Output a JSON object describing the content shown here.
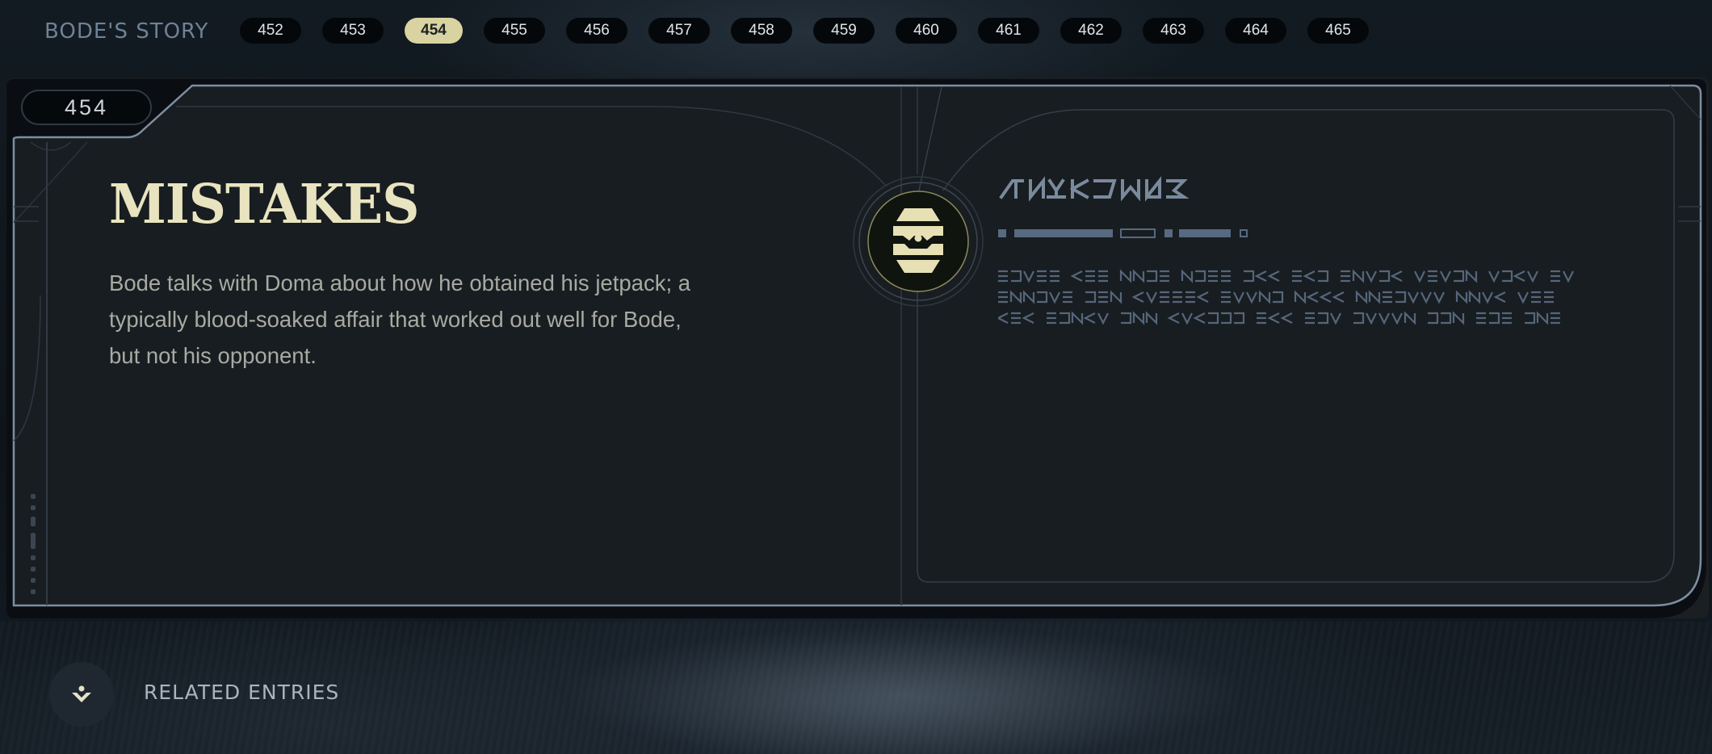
{
  "story": {
    "title": "BODE'S STORY",
    "tabs": [
      {
        "label": "452",
        "active": false
      },
      {
        "label": "453",
        "active": false
      },
      {
        "label": "454",
        "active": true
      },
      {
        "label": "455",
        "active": false
      },
      {
        "label": "456",
        "active": false
      },
      {
        "label": "457",
        "active": false
      },
      {
        "label": "458",
        "active": false
      },
      {
        "label": "459",
        "active": false
      },
      {
        "label": "460",
        "active": false
      },
      {
        "label": "461",
        "active": false
      },
      {
        "label": "462",
        "active": false
      },
      {
        "label": "463",
        "active": false
      },
      {
        "label": "464",
        "active": false
      },
      {
        "label": "465",
        "active": false
      }
    ]
  },
  "entry": {
    "number": "454",
    "title": "MISTAKES",
    "description": "Bode talks with Doma about how he obtained his jetpack; a typically blood-soaked affair that worked out well for Bode, but not his opponent.",
    "emblem_icon": "faction-emblem-icon"
  },
  "related": {
    "label": "RELATED ENTRIES",
    "icon": "related-entries-icon"
  },
  "colors": {
    "accent": "#d8d3a0",
    "title": "#e8e4bf",
    "frame": "#5c6f82",
    "aurebesh": "#55667a"
  }
}
